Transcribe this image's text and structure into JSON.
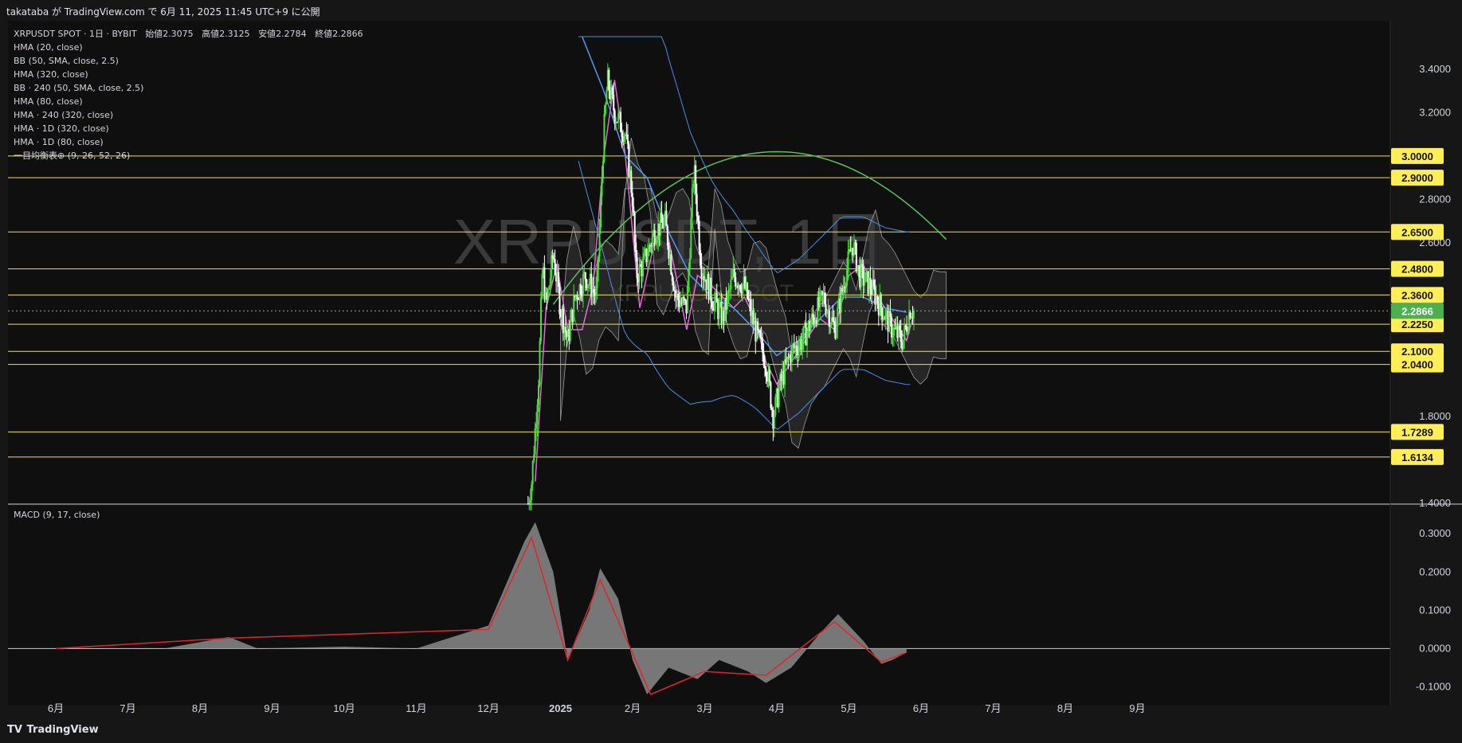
{
  "header": {
    "publish_text": "takataba が TradingView.com で 6月 11, 2025 11:45 UTC+9 に公開"
  },
  "symbol": {
    "line_prefix": "XRPUSDT SPOT · 1日 · BYBIT",
    "open_label": "始値",
    "open": "2.3075",
    "high_label": "高値",
    "high": "2.3125",
    "low_label": "安値",
    "low": "2.2784",
    "close_label": "終値",
    "close": "2.2866"
  },
  "indicators": [
    "HMA (20, close)",
    "BB (50, SMA, close, 2.5)",
    "HMA (320, close)",
    "BB · 240 (50, SMA, close, 2.5)",
    "HMA (80, close)",
    "HMA · 240 (320, close)",
    "HMA · 1D (320, close)",
    "HMA · 1D (80, close)",
    "一目均衡表⊕ (9, 26, 52, 26)"
  ],
  "watermark": {
    "main": "XRPUSDT, 1日",
    "sub": "XRPUSDT SPOT"
  },
  "macd_label": "MACD (9, 17, close)",
  "brand": {
    "logo": "TV",
    "name": "TradingView"
  },
  "colors": {
    "background": "#161616",
    "panel": "#0f0f0f",
    "up_candle": "#4ade3a",
    "down_candle": "#ffffff",
    "level_line": "#f2e34c",
    "level_badge": "#ffee58",
    "current_badge": "#4caf50",
    "bb_band": "#4f8ddf",
    "hma_fast": "#e06ad6",
    "hma_mid": "#4f9cf0",
    "hma_slow": "#58c25a",
    "cloud": "#9a9a9a",
    "macd_fill": "#8a8a8a",
    "macd_signal": "#e0262d"
  },
  "chart_data": {
    "type": "candlestick",
    "symbol": "XRPUSDT SPOT",
    "interval": "1日",
    "ylim": [
      1.4,
      3.55
    ],
    "y_ticks": [
      1.4,
      1.8,
      2.6,
      2.8,
      3.2,
      3.4
    ],
    "y_tick_labels": [
      "1.4000",
      "1.8000",
      "2.6000",
      "2.8000",
      "3.2000",
      "3.4000"
    ],
    "horizontal_levels": [
      3.0,
      2.9,
      2.65,
      2.48,
      2.36,
      2.225,
      2.1,
      2.04,
      1.7289,
      1.6134
    ],
    "horizontal_level_labels": [
      "3.0000",
      "2.9000",
      "2.6500",
      "2.4800",
      "2.3600",
      "2.2250",
      "2.1000",
      "2.0400",
      "1.7289",
      "1.6134"
    ],
    "current_price": 2.2866,
    "current_price_label": "2.2866",
    "x_axis_labels": [
      {
        "label": "6月",
        "month": 0
      },
      {
        "label": "7月",
        "month": 1
      },
      {
        "label": "8月",
        "month": 2
      },
      {
        "label": "9月",
        "month": 3
      },
      {
        "label": "10月",
        "month": 4
      },
      {
        "label": "11月",
        "month": 5
      },
      {
        "label": "12月",
        "month": 6
      },
      {
        "label": "2025",
        "month": 7
      },
      {
        "label": "2月",
        "month": 8
      },
      {
        "label": "3月",
        "month": 9
      },
      {
        "label": "4月",
        "month": 10
      },
      {
        "label": "5月",
        "month": 11
      },
      {
        "label": "6月",
        "month": 12
      },
      {
        "label": "7月",
        "month": 13
      },
      {
        "label": "8月",
        "month": 14
      },
      {
        "label": "9月",
        "month": 15
      }
    ],
    "price_path": [
      [
        6.55,
        1.4
      ],
      [
        6.6,
        1.5
      ],
      [
        6.7,
        2.0
      ],
      [
        6.75,
        2.5
      ],
      [
        6.8,
        2.3
      ],
      [
        6.9,
        2.55
      ],
      [
        7.0,
        2.3
      ],
      [
        7.1,
        2.15
      ],
      [
        7.2,
        2.35
      ],
      [
        7.35,
        2.45
      ],
      [
        7.5,
        2.35
      ],
      [
        7.6,
        3.1
      ],
      [
        7.65,
        3.35
      ],
      [
        7.75,
        3.2
      ],
      [
        7.9,
        3.1
      ],
      [
        8.0,
        2.8
      ],
      [
        8.05,
        2.45
      ],
      [
        8.15,
        2.5
      ],
      [
        8.3,
        2.65
      ],
      [
        8.45,
        2.7
      ],
      [
        8.6,
        2.35
      ],
      [
        8.75,
        2.3
      ],
      [
        8.85,
        2.95
      ],
      [
        8.95,
        2.5
      ],
      [
        9.1,
        2.35
      ],
      [
        9.25,
        2.25
      ],
      [
        9.4,
        2.45
      ],
      [
        9.55,
        2.4
      ],
      [
        9.7,
        2.2
      ],
      [
        9.85,
        2.05
      ],
      [
        9.95,
        1.8
      ],
      [
        10.05,
        1.95
      ],
      [
        10.2,
        2.1
      ],
      [
        10.35,
        2.15
      ],
      [
        10.5,
        2.25
      ],
      [
        10.65,
        2.35
      ],
      [
        10.8,
        2.2
      ],
      [
        10.95,
        2.45
      ],
      [
        11.05,
        2.6
      ],
      [
        11.15,
        2.45
      ],
      [
        11.3,
        2.4
      ],
      [
        11.45,
        2.3
      ],
      [
        11.6,
        2.2
      ],
      [
        11.75,
        2.15
      ],
      [
        11.85,
        2.3
      ],
      [
        11.9,
        2.2866
      ]
    ],
    "series": [
      {
        "name": "HMA (20, close)",
        "points": [
          [
            6.65,
            1.5
          ],
          [
            6.8,
            2.3
          ],
          [
            6.95,
            2.5
          ],
          [
            7.1,
            2.2
          ],
          [
            7.3,
            2.2
          ],
          [
            7.45,
            2.4
          ],
          [
            7.6,
            3.0
          ],
          [
            7.75,
            3.35
          ],
          [
            7.9,
            3.0
          ],
          [
            8.1,
            2.3
          ],
          [
            8.3,
            2.6
          ],
          [
            8.45,
            2.7
          ],
          [
            8.6,
            2.45
          ],
          [
            8.75,
            2.2
          ],
          [
            8.9,
            2.45
          ],
          [
            9.1,
            2.4
          ],
          [
            9.25,
            2.35
          ],
          [
            9.4,
            2.3
          ],
          [
            9.55,
            2.35
          ],
          [
            9.7,
            2.25
          ],
          [
            9.85,
            2.05
          ],
          [
            10.0,
            1.95
          ],
          [
            10.2,
            2.05
          ],
          [
            10.4,
            2.15
          ],
          [
            10.6,
            2.25
          ],
          [
            10.8,
            2.2
          ],
          [
            11.0,
            2.45
          ],
          [
            11.2,
            2.5
          ],
          [
            11.4,
            2.35
          ],
          [
            11.6,
            2.25
          ],
          [
            11.8,
            2.15
          ],
          [
            11.9,
            2.27
          ]
        ]
      },
      {
        "name": "BB (50, SMA, close, 2.5)",
        "points": [
          [
            7.3,
            3.55
          ],
          [
            7.6,
            3.3
          ],
          [
            7.9,
            3.0
          ],
          [
            8.2,
            2.9
          ],
          [
            8.5,
            2.65
          ],
          [
            8.8,
            2.45
          ],
          [
            9.1,
            2.35
          ],
          [
            9.4,
            2.3
          ],
          [
            9.7,
            2.2
          ],
          [
            10.0,
            2.08
          ],
          [
            10.3,
            2.15
          ],
          [
            10.6,
            2.25
          ],
          [
            10.9,
            2.35
          ],
          [
            11.2,
            2.35
          ],
          [
            11.5,
            2.3
          ],
          [
            11.8,
            2.28
          ]
        ]
      }
    ],
    "macd": {
      "ylim": [
        -0.12,
        0.34
      ],
      "y_ticks": [
        -0.1,
        0.0,
        0.1,
        0.2,
        0.3
      ],
      "y_tick_labels": [
        "-0.1000",
        "0.0000",
        "0.1000",
        "0.2000",
        "0.3000"
      ],
      "histogram": [
        [
          0.0,
          0.0
        ],
        [
          1.5,
          0.0
        ],
        [
          2.4,
          0.03
        ],
        [
          2.8,
          0.0
        ],
        [
          4.0,
          0.005
        ],
        [
          5.0,
          0.0
        ],
        [
          6.0,
          0.06
        ],
        [
          6.5,
          0.28
        ],
        [
          6.65,
          0.33
        ],
        [
          6.9,
          0.2
        ],
        [
          7.1,
          -0.03
        ],
        [
          7.4,
          0.1
        ],
        [
          7.55,
          0.21
        ],
        [
          7.8,
          0.13
        ],
        [
          8.0,
          -0.03
        ],
        [
          8.2,
          -0.12
        ],
        [
          8.5,
          -0.05
        ],
        [
          8.9,
          -0.08
        ],
        [
          9.2,
          -0.03
        ],
        [
          9.6,
          -0.06
        ],
        [
          9.85,
          -0.09
        ],
        [
          10.2,
          -0.05
        ],
        [
          10.6,
          0.04
        ],
        [
          10.85,
          0.09
        ],
        [
          11.2,
          0.02
        ],
        [
          11.45,
          -0.04
        ],
        [
          11.6,
          -0.03
        ],
        [
          11.8,
          -0.01
        ]
      ],
      "signal": [
        [
          0.0,
          0.0
        ],
        [
          2.4,
          0.027
        ],
        [
          6.0,
          0.05
        ],
        [
          6.6,
          0.29
        ],
        [
          7.1,
          -0.03
        ],
        [
          7.55,
          0.18
        ],
        [
          8.25,
          -0.12
        ],
        [
          9.0,
          -0.06
        ],
        [
          9.85,
          -0.07
        ],
        [
          10.8,
          0.07
        ],
        [
          11.45,
          -0.035
        ],
        [
          11.8,
          -0.01
        ]
      ]
    }
  }
}
